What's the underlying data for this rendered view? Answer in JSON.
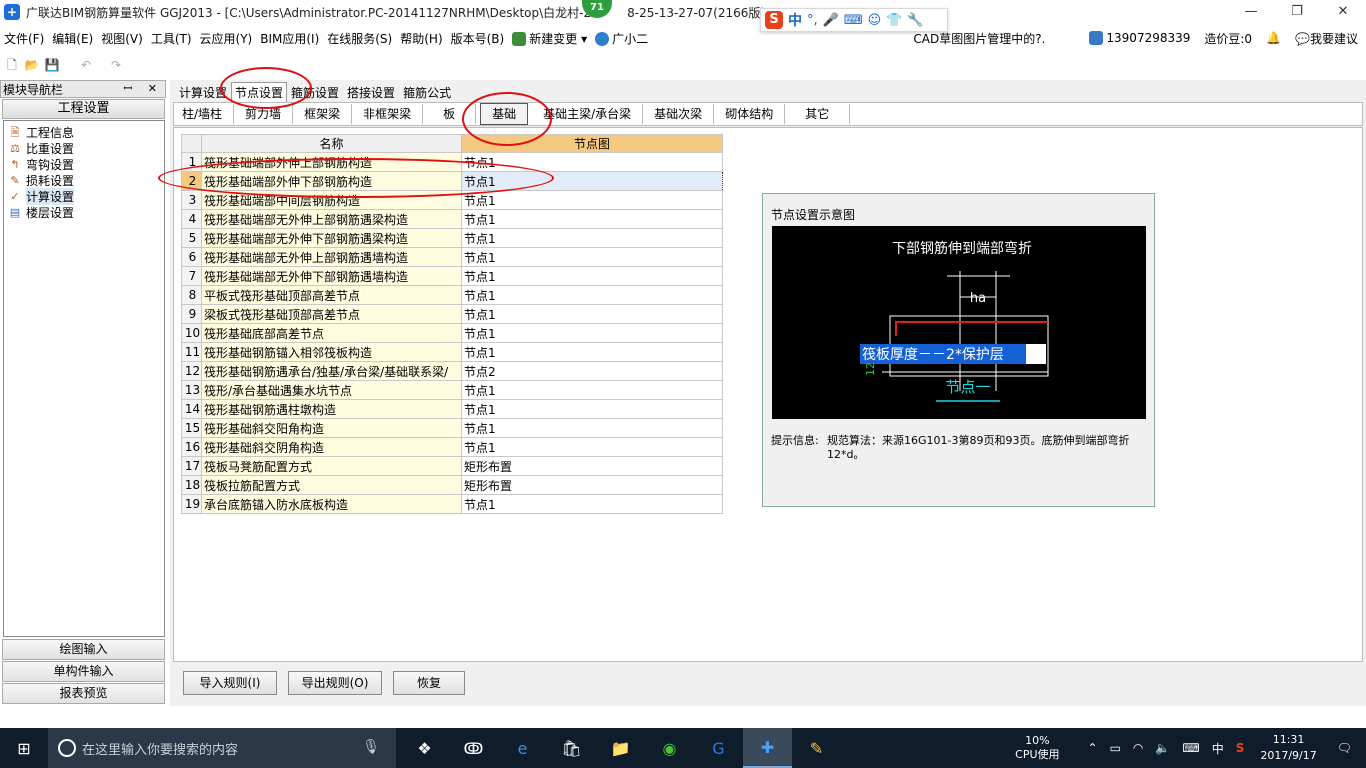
{
  "window": {
    "title": "广联达BIM钢筋算量软件 GGJ2013 - [C:\\Users\\Administrator.PC-20141127NRHM\\Desktop\\白龙村-2",
    "title_tail": "8-25-13-27-07(2166版)_16",
    "minimize": "—",
    "maximize": "❐",
    "close": "✕",
    "badge": "71"
  },
  "ime": {
    "logo": "S",
    "mode": "中"
  },
  "menu": {
    "items": [
      "文件(F)",
      "编辑(E)",
      "视图(V)",
      "工具(T)",
      "云应用(Y)",
      "BIM应用(I)",
      "在线服务(S)",
      "帮助(H)",
      "版本号(B)",
      "新建变更",
      "广小二"
    ],
    "right_items": [
      "CAD草图图片管理中的?.",
      "13907298339",
      "造价豆:0",
      "我要建议"
    ]
  },
  "nav": {
    "header": "模块导航栏",
    "header_buttons": "ꟷ ✕",
    "section": "工程设置",
    "tree": [
      "工程信息",
      "比重设置",
      "弯钩设置",
      "损耗设置",
      "计算设置",
      "楼层设置"
    ],
    "selected_index": 4,
    "bottom_buttons": [
      "绘图输入",
      "单构件输入",
      "报表预览"
    ]
  },
  "tabs_top": [
    "计算设置",
    "节点设置",
    "箍筋设置",
    "搭接设置",
    "箍筋公式"
  ],
  "tabs_top_active": 1,
  "tabs_sub": [
    "柱/墙柱",
    "剪力墙",
    "框架梁",
    "非框架梁",
    "板",
    "基础",
    "基础主梁/承台梁",
    "基础次梁",
    "砌体结构",
    "其它"
  ],
  "tabs_sub_active": 5,
  "grid": {
    "headers": [
      "名称",
      "节点图"
    ],
    "rows": [
      {
        "no": "1",
        "name": "筏形基础端部外伸上部钢筋构造",
        "value": "节点1"
      },
      {
        "no": "2",
        "name": "筏形基础端部外伸下部钢筋构造",
        "value": "节点1"
      },
      {
        "no": "3",
        "name": "筏形基础端部中间层钢筋构造",
        "value": "节点1"
      },
      {
        "no": "4",
        "name": "筏形基础端部无外伸上部钢筋遇梁构造",
        "value": "节点1"
      },
      {
        "no": "5",
        "name": "筏形基础端部无外伸下部钢筋遇梁构造",
        "value": "节点1"
      },
      {
        "no": "6",
        "name": "筏形基础端部无外伸上部钢筋遇墙构造",
        "value": "节点1"
      },
      {
        "no": "7",
        "name": "筏形基础端部无外伸下部钢筋遇墙构造",
        "value": "节点1"
      },
      {
        "no": "8",
        "name": "平板式筏形基础顶部高差节点",
        "value": "节点1"
      },
      {
        "no": "9",
        "name": "梁板式筏形基础顶部高差节点",
        "value": "节点1"
      },
      {
        "no": "10",
        "name": "筏形基础底部高差节点",
        "value": "节点1"
      },
      {
        "no": "11",
        "name": "筏形基础钢筋锚入相邻筏板构造",
        "value": "节点1"
      },
      {
        "no": "12",
        "name": "筏形基础钢筋遇承台/独基/承台梁/基础联系梁/",
        "value": "节点2"
      },
      {
        "no": "13",
        "name": "筏形/承台基础遇集水坑节点",
        "value": "节点1"
      },
      {
        "no": "14",
        "name": "筏形基础钢筋遇柱墩构造",
        "value": "节点1"
      },
      {
        "no": "15",
        "name": "筏形基础斜交阳角构造",
        "value": "节点1"
      },
      {
        "no": "16",
        "name": "筏形基础斜交阴角构造",
        "value": "节点1"
      },
      {
        "no": "17",
        "name": "筏板马凳筋配置方式",
        "value": "矩形布置"
      },
      {
        "no": "18",
        "name": "筏板拉筋配置方式",
        "value": "矩形布置"
      },
      {
        "no": "19",
        "name": "承台底筋锚入防水底板构造",
        "value": "节点1"
      }
    ],
    "selected_row": 1
  },
  "node_panel": {
    "title": "节点设置示意图",
    "diagram_heading": "下部钢筋伸到端部弯折",
    "dim_ha": "ha",
    "thickness_label": "筏板厚度－－2*保护层",
    "side_label": "12",
    "node_name": "节点一",
    "tip_label": "提示信息:",
    "tip_text": "规范算法：来源16G101-3第89页和93页。底筋伸到端部弯折12*d。"
  },
  "buttons": {
    "import": "导入规则(I)",
    "export": "导出规则(O)",
    "restore": "恢复"
  },
  "taskbar": {
    "search_placeholder": "在这里输入你要搜索的内容",
    "cpu_pct": "10%",
    "cpu_label": "CPU使用",
    "ime": "中",
    "time": "11:31",
    "date": "2017/9/17"
  },
  "colors": {
    "accent_header": "#f5c97f",
    "name_cell": "#fffce0",
    "annotation_red": "#e01010",
    "diagram_cyan": "#1ad6e0",
    "diagram_red": "#e02020",
    "selection_blue": "#1560d4"
  }
}
